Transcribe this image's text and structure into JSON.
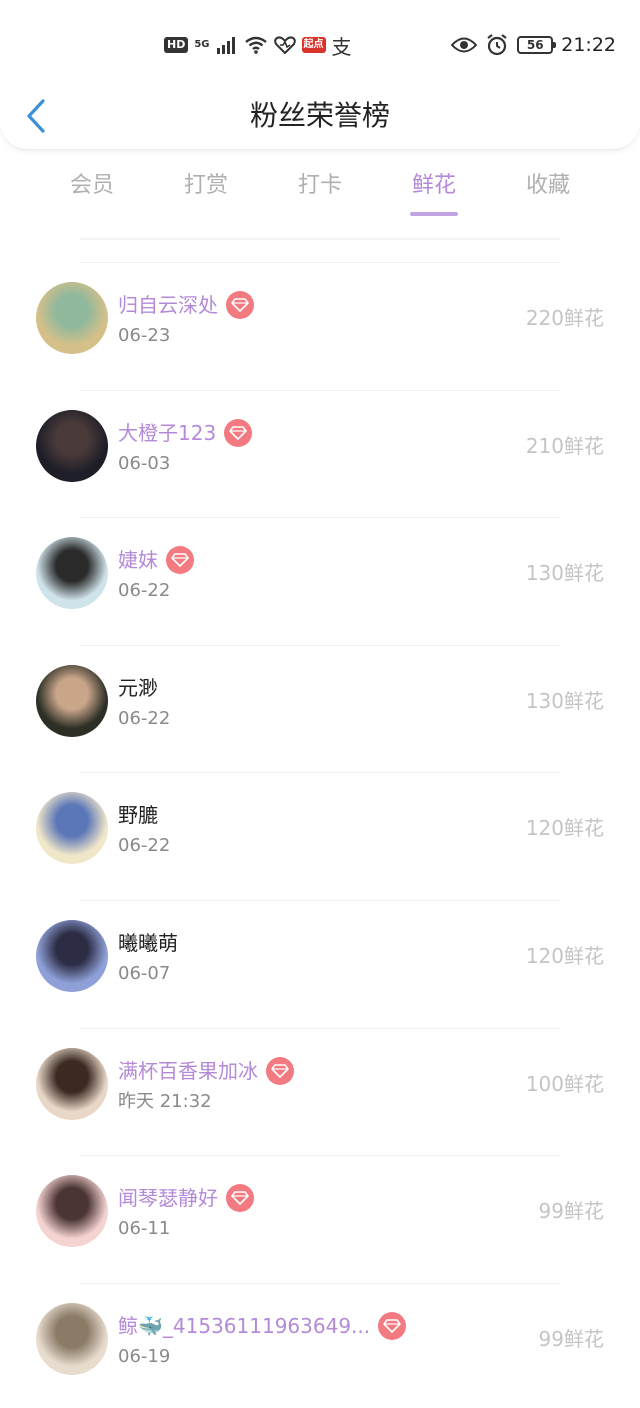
{
  "status_bar": {
    "left_badges": [
      "HD",
      "5G"
    ],
    "app_badge": "起点",
    "zhi": "支",
    "battery": "56",
    "time": "21:22"
  },
  "header": {
    "title": "粉丝荣誉榜"
  },
  "tabs": [
    {
      "label": "会员",
      "active": false
    },
    {
      "label": "打赏",
      "active": false
    },
    {
      "label": "打卡",
      "active": false
    },
    {
      "label": "鲜花",
      "active": true
    },
    {
      "label": "收藏",
      "active": false
    }
  ],
  "fans": [
    {
      "name": "归自云深处",
      "date": "06-23",
      "amount": "220鲜花",
      "vip": true,
      "avatar_colors": [
        "#d6c08a",
        "#8fb89c"
      ]
    },
    {
      "name": "大橙子123",
      "date": "06-03",
      "amount": "210鲜花",
      "vip": true,
      "avatar_colors": [
        "#1e1e28",
        "#4a3a3a"
      ]
    },
    {
      "name": "婕妺",
      "date": "06-22",
      "amount": "130鲜花",
      "vip": true,
      "avatar_colors": [
        "#cfe3ea",
        "#2a2a2a"
      ]
    },
    {
      "name": "元渺",
      "date": "06-22",
      "amount": "130鲜花",
      "vip": false,
      "avatar_colors": [
        "#2d2f26",
        "#c9a58a"
      ]
    },
    {
      "name": "野膔",
      "date": "06-22",
      "amount": "120鲜花",
      "vip": false,
      "avatar_colors": [
        "#f0e6c8",
        "#5c77b8"
      ]
    },
    {
      "name": "曦曦萌",
      "date": "06-07",
      "amount": "120鲜花",
      "vip": false,
      "avatar_colors": [
        "#8fa0d8",
        "#2c2c44"
      ]
    },
    {
      "name": "满杯百香果加冰",
      "date": "昨天 21:32",
      "amount": "100鲜花",
      "vip": true,
      "avatar_colors": [
        "#e9d8c8",
        "#3a2a22"
      ]
    },
    {
      "name": "闻琴瑟静好",
      "date": "06-11",
      "amount": "99鲜花",
      "vip": true,
      "avatar_colors": [
        "#f4d3d0",
        "#4a3434"
      ]
    },
    {
      "name": "鲸🐳_41536111963649...",
      "date": "06-19",
      "amount": "99鲜花",
      "vip": true,
      "avatar_colors": [
        "#e8dccf",
        "#8a7a66"
      ]
    }
  ],
  "colors": {
    "accent": "#b48ad8",
    "badge": "#f27a80",
    "back_arrow": "#3a8fd8"
  }
}
